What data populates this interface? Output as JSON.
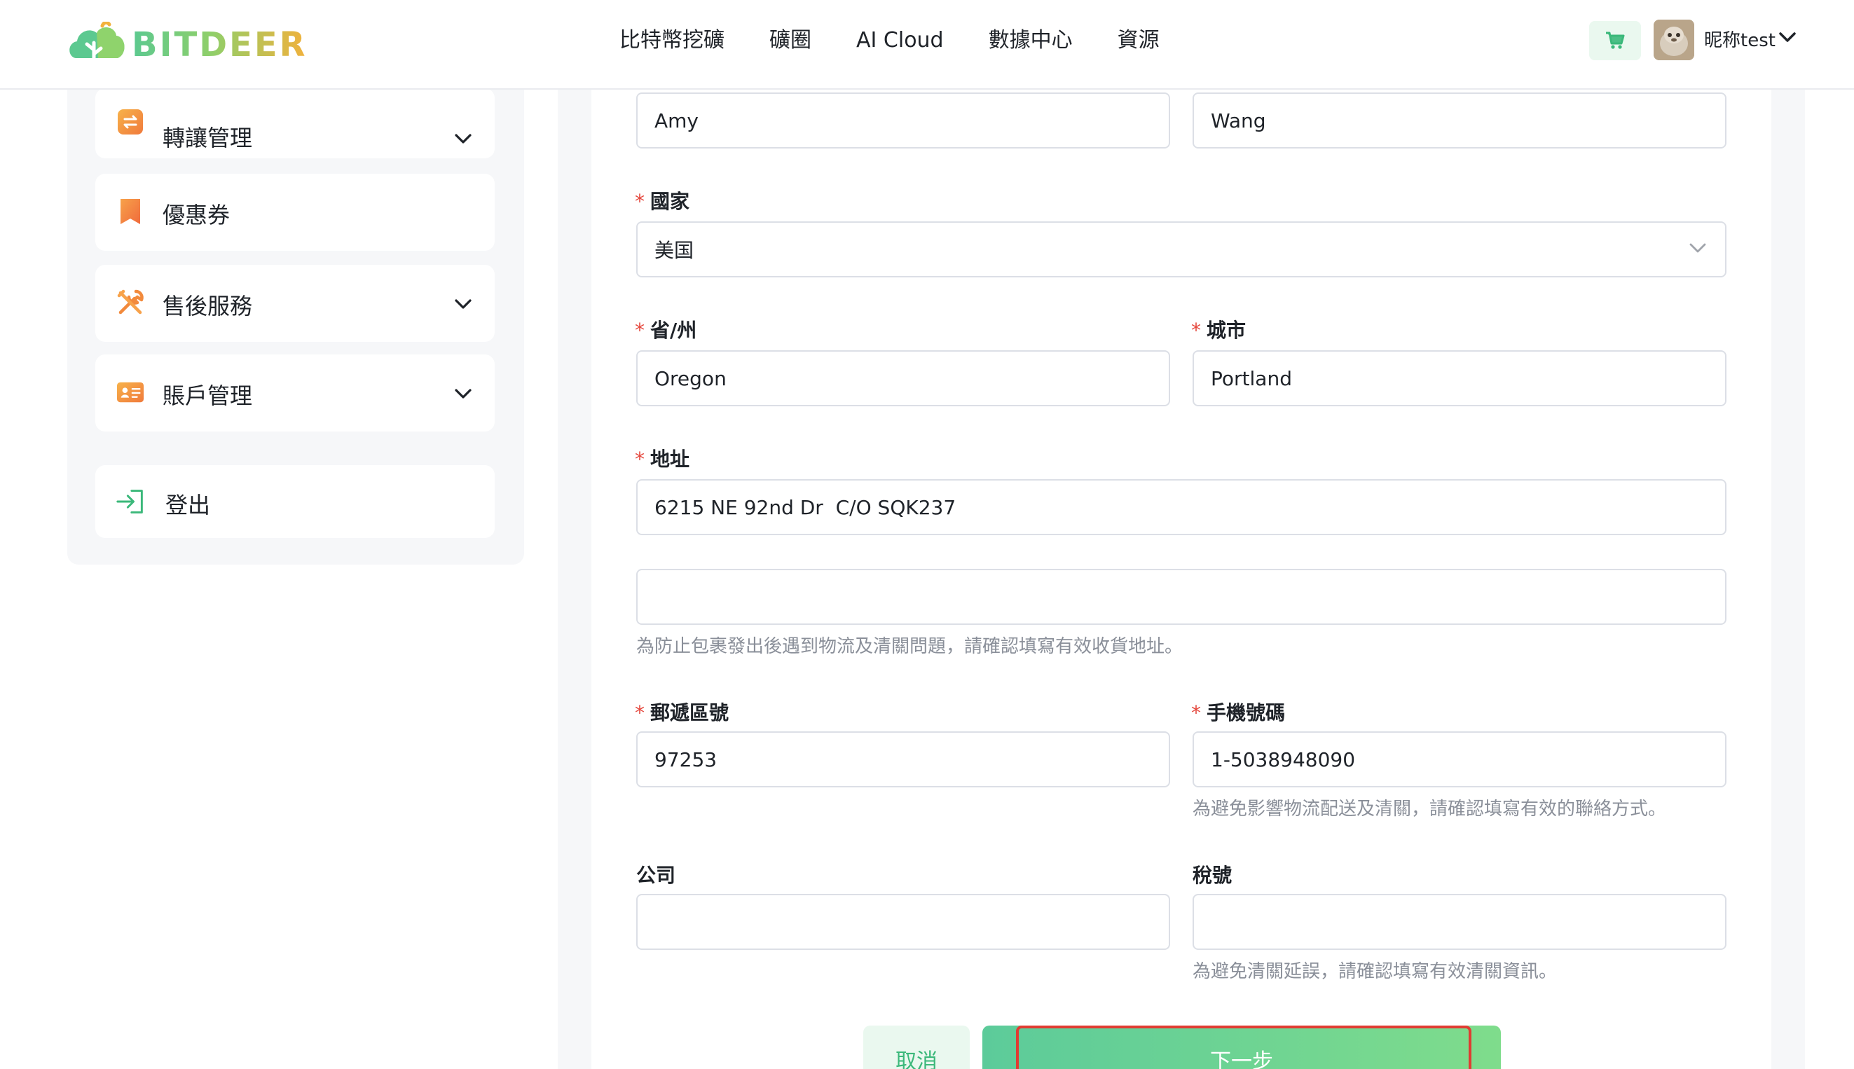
{
  "brand": {
    "name": "BITDEER",
    "accent": "#5cc990",
    "accent_end": "#f2b13c"
  },
  "nav": {
    "items": [
      "比特幣挖礦",
      "礦圈",
      "AI Cloud",
      "數據中心",
      "資源"
    ]
  },
  "header": {
    "cart_icon": "cart-icon",
    "user_name": "昵称test"
  },
  "sidebar": {
    "items": [
      {
        "label": "轉讓管理",
        "icon": "transfer-icon",
        "has_children": true
      },
      {
        "label": "優惠券",
        "icon": "coupon-icon",
        "has_children": false
      },
      {
        "label": "售後服務",
        "icon": "tools-icon",
        "has_children": true
      },
      {
        "label": "賬戶管理",
        "icon": "id-card-icon",
        "has_children": true
      },
      {
        "label": "登出",
        "icon": "logout-icon",
        "has_children": false
      }
    ]
  },
  "form": {
    "first_name": {
      "value": "Amy"
    },
    "last_name": {
      "value": "Wang"
    },
    "country": {
      "label": "國家",
      "value": "美国"
    },
    "state": {
      "label": "省/州",
      "value": "Oregon"
    },
    "city": {
      "label": "城市",
      "value": "Portland"
    },
    "address": {
      "label": "地址",
      "value": "6215 NE 92nd Dr  C/O SQK237"
    },
    "address2": {
      "value": ""
    },
    "address_hint": "為防止包裹發出後遇到物流及清關問題，請確認填寫有效收貨地址。",
    "zip": {
      "label": "郵遞區號",
      "value": "97253"
    },
    "phone": {
      "label": "手機號碼",
      "value": "1-5038948090"
    },
    "phone_hint": "為避免影響物流配送及清關，請確認填寫有效的聯絡方式。",
    "company": {
      "label": "公司",
      "value": ""
    },
    "tax_id": {
      "label": "稅號",
      "value": ""
    },
    "tax_hint": "為避免清關延誤，請確認填寫有效清關資訊。",
    "required_mark": "*"
  },
  "actions": {
    "cancel_label": "取消",
    "next_label": "下一步"
  }
}
